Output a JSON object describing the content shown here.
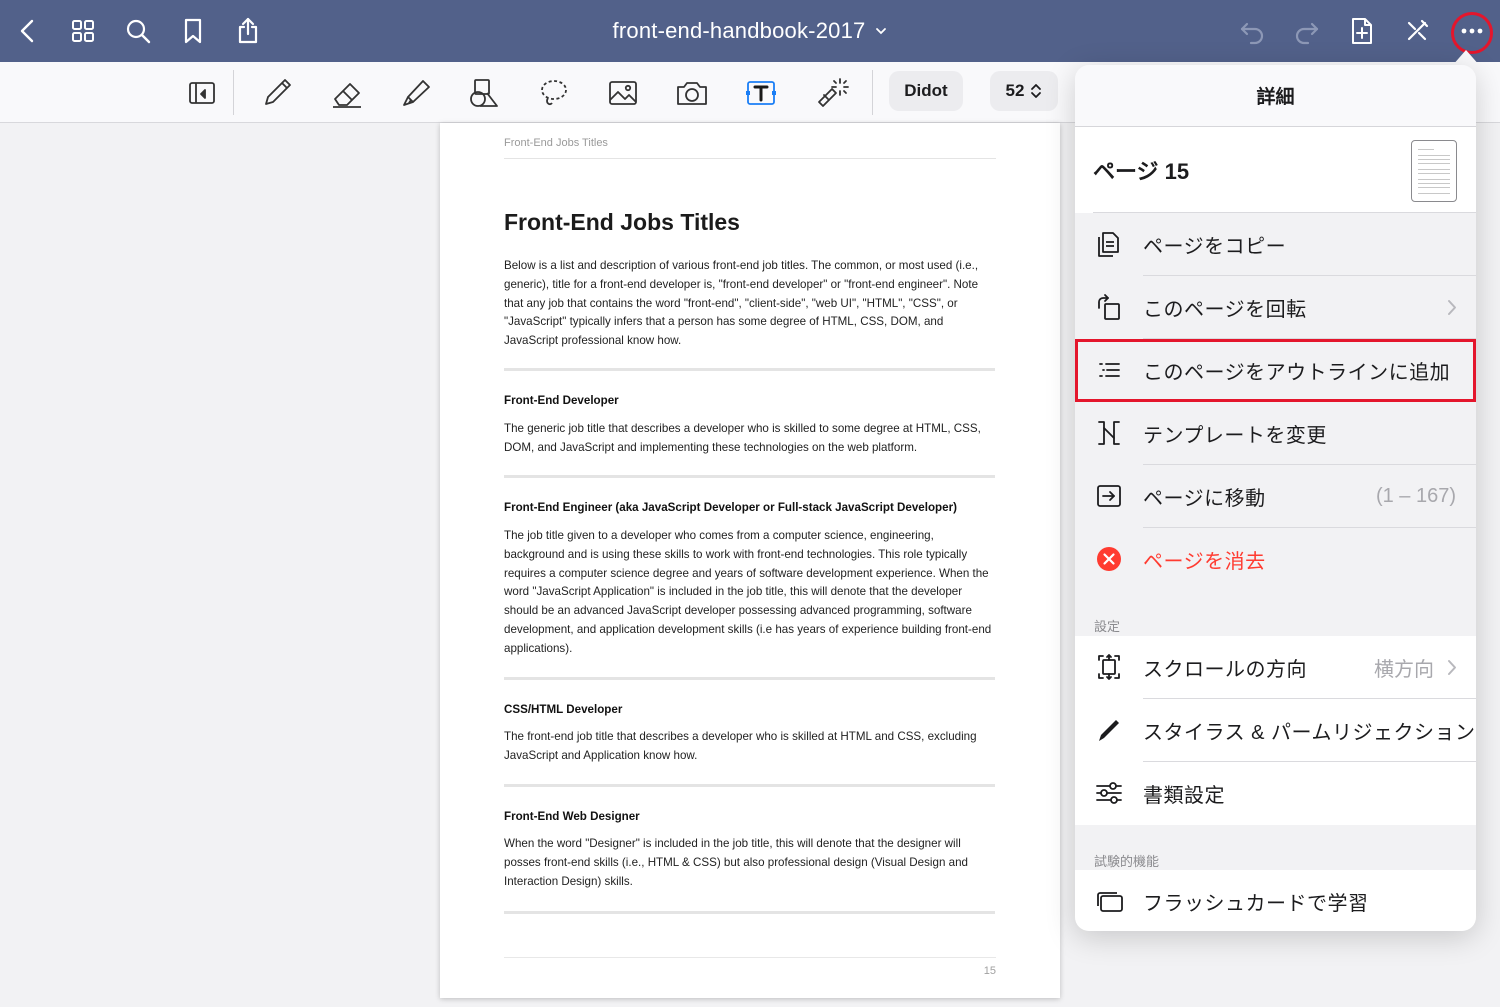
{
  "colors": {
    "nav_bar": "#52618a",
    "highlight_ring": "#e4162c",
    "danger": "#ff3b30",
    "active_tool": "#1a7ef5"
  },
  "topbar": {
    "title": "front-end-handbook-2017",
    "icons": [
      "back-chevron-icon",
      "grid-icon",
      "search-icon",
      "bookmark-icon",
      "share-icon",
      "undo-icon",
      "redo-icon",
      "add-page-icon",
      "close-toolbar-icon",
      "more-icon"
    ]
  },
  "toolbar": {
    "tools": [
      "tablet-view-icon",
      "pen-icon",
      "eraser-icon",
      "highlighter-icon",
      "shapes-icon",
      "lasso-icon",
      "image-icon",
      "camera-icon",
      "text-tool-icon",
      "laser-pointer-icon"
    ],
    "font_name": "Didot",
    "font_size": "52"
  },
  "document": {
    "running_header": "Front-End Jobs Titles",
    "title": "Front-End Jobs Titles",
    "intro": "Below is a list and description of various front-end job titles. The common, or most used (i.e., generic), title for a front-end developer is, \"front-end developer\" or \"front-end engineer\". Note that any job that contains the word \"front-end\", \"client-side\", \"web UI\", \"HTML\", \"CSS\", or \"JavaScript\" typically infers that a person has some degree of HTML, CSS, DOM, and JavaScript professional know how.",
    "sections": [
      {
        "heading": "Front-End Developer",
        "body": "The generic job title that describes a developer who is skilled to some degree at HTML, CSS, DOM, and JavaScript and implementing these technologies on the web platform."
      },
      {
        "heading": "Front-End Engineer (aka JavaScript Developer or Full-stack JavaScript Developer)",
        "body": "The job title given to a developer who comes from a computer science, engineering, background and is using these skills to work with front-end technologies. This role typically requires a computer science degree and years of software development experience. When the word \"JavaScript Application\" is included in the job title, this will denote that the developer should be an advanced JavaScript developer possessing advanced programming, software development, and application development skills (i.e has years of experience building front-end applications)."
      },
      {
        "heading": "CSS/HTML Developer",
        "body": "The front-end job title that describes a developer who is skilled at HTML and CSS, excluding JavaScript and Application know how."
      },
      {
        "heading": "Front-End Web Designer",
        "body": "When the word \"Designer\" is included in the job title, this will denote that the designer will posses front-end skills (i.e., HTML & CSS) but also professional design (Visual Design and Interaction Design) skills."
      }
    ],
    "page_number": "15"
  },
  "popover": {
    "title": "詳細",
    "page_label": "ページ 15",
    "actions": [
      {
        "label": "ページをコピー",
        "icon": "copy-page-icon"
      },
      {
        "label": "このページを回転",
        "icon": "rotate-page-icon"
      },
      {
        "label": "このページをアウトラインに追加",
        "icon": "outline-list-icon"
      },
      {
        "label": "テンプレートを変更",
        "icon": "template-icon"
      },
      {
        "label": "ページに移動",
        "icon": "go-to-page-icon",
        "value": "(1 – 167)"
      },
      {
        "label": "ページを消去",
        "icon": "delete-page-icon"
      }
    ],
    "settings_header": "設定",
    "settings": [
      {
        "label": "スクロールの方向",
        "icon": "scroll-direction-icon",
        "value": "横方向"
      },
      {
        "label": "スタイラス & パームリジェクション",
        "icon": "stylus-icon"
      },
      {
        "label": "書類設定",
        "icon": "sliders-icon"
      }
    ],
    "experimental_header": "試験的機能",
    "experimental": [
      {
        "label": "フラッシュカードで学習",
        "icon": "flashcards-icon"
      }
    ]
  }
}
